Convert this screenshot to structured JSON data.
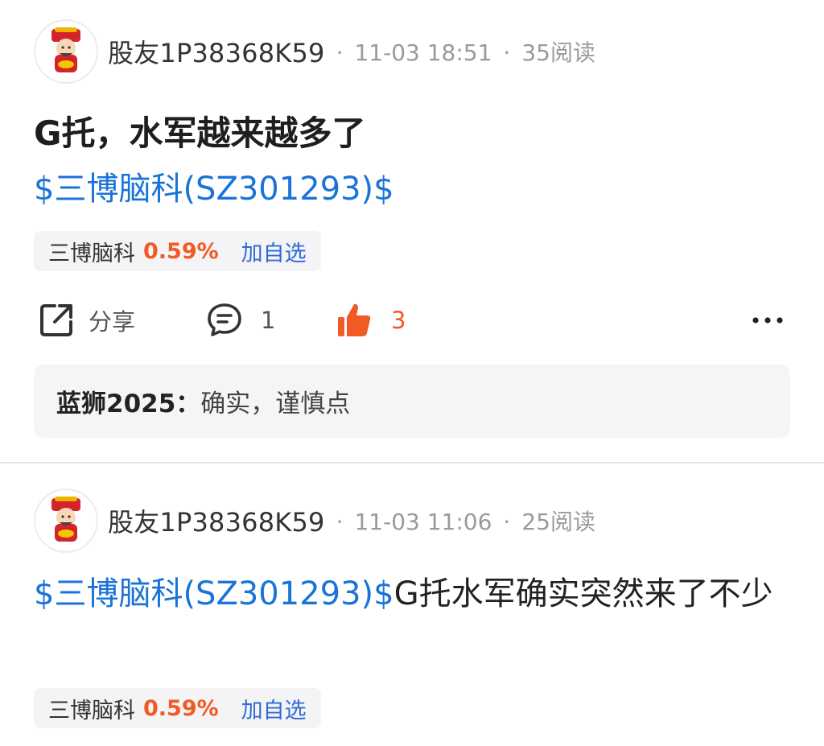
{
  "posts": [
    {
      "author": "股友1P38368K59",
      "date": "11-03 18:51",
      "reads": "35阅读",
      "title": "G托，水军越来越多了",
      "stock_link": "$三博脑科(SZ301293)$",
      "body_text": "",
      "chip": {
        "name": "三博脑科",
        "change": "0.59%",
        "add_label": "加自选"
      },
      "actions": {
        "share_label": "分享",
        "comment_count": "1",
        "like_count": "3"
      },
      "reply": {
        "user": "蓝狮2025：",
        "text": "确实，谨慎点"
      }
    },
    {
      "author": "股友1P38368K59",
      "date": "11-03 11:06",
      "reads": "25阅读",
      "title": "",
      "stock_link": "$三博脑科(SZ301293)$",
      "body_text": "G托水军确实突然来了不少",
      "chip": {
        "name": "三博脑科",
        "change": "0.59%",
        "add_label": "加自选"
      }
    }
  ],
  "meta_separator": "·",
  "colors": {
    "link": "#1a73d9",
    "up": "#f15a24",
    "add": "#2f6bd6",
    "chip_bg": "#f4f4f6"
  },
  "icons": {
    "share": "share-icon",
    "comment": "comment-icon",
    "like": "thumbs-up-icon",
    "more": "more-icon",
    "avatar": "fortune-god-avatar"
  }
}
